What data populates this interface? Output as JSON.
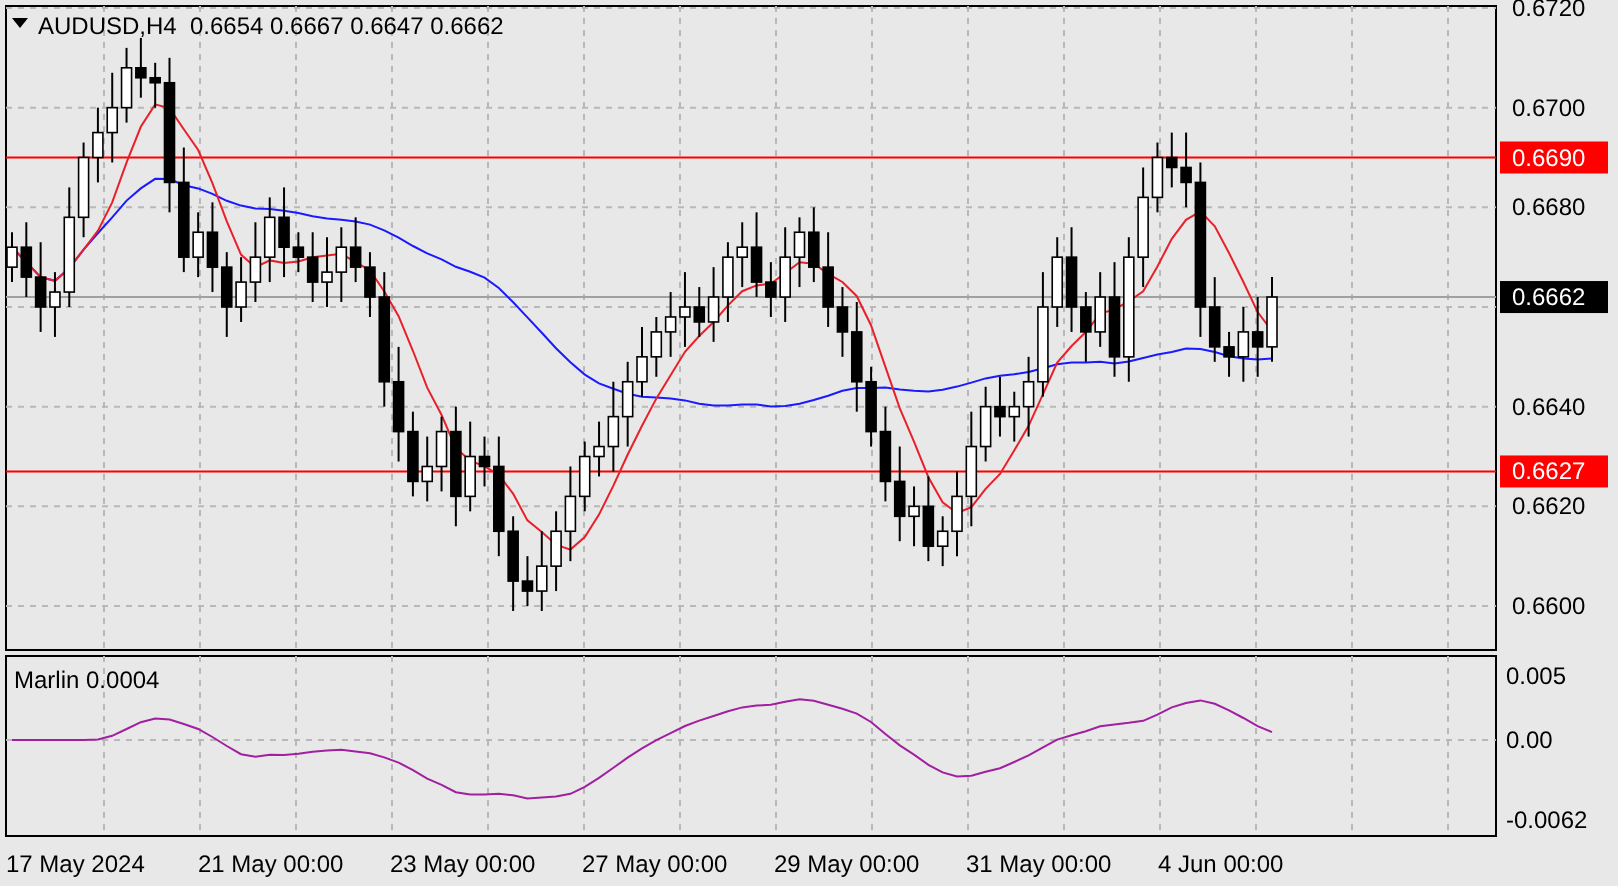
{
  "header": {
    "symbol": "AUDUSD,H4",
    "ohlc": "0.6654 0.6667 0.6647 0.6662"
  },
  "price_axis": {
    "ticks": [
      "0.6720",
      "0.6700",
      "0.6680",
      "0.6640",
      "0.6620",
      "0.6600"
    ]
  },
  "levels": [
    {
      "label": "0.6690",
      "color": "#ff0000"
    },
    {
      "label": "0.6627",
      "color": "#ff0000"
    }
  ],
  "current_price": {
    "label": "0.6662"
  },
  "indicator": {
    "name": "Marlin 0.0004",
    "ticks": [
      "0.005",
      "0.00",
      "-0.0062"
    ]
  },
  "time_axis": [
    "17 May 2024",
    "21 May 00:00",
    "23 May 00:00",
    "27 May 00:00",
    "29 May 00:00",
    "31 May 00:00",
    "4 Jun 00:00"
  ]
}
